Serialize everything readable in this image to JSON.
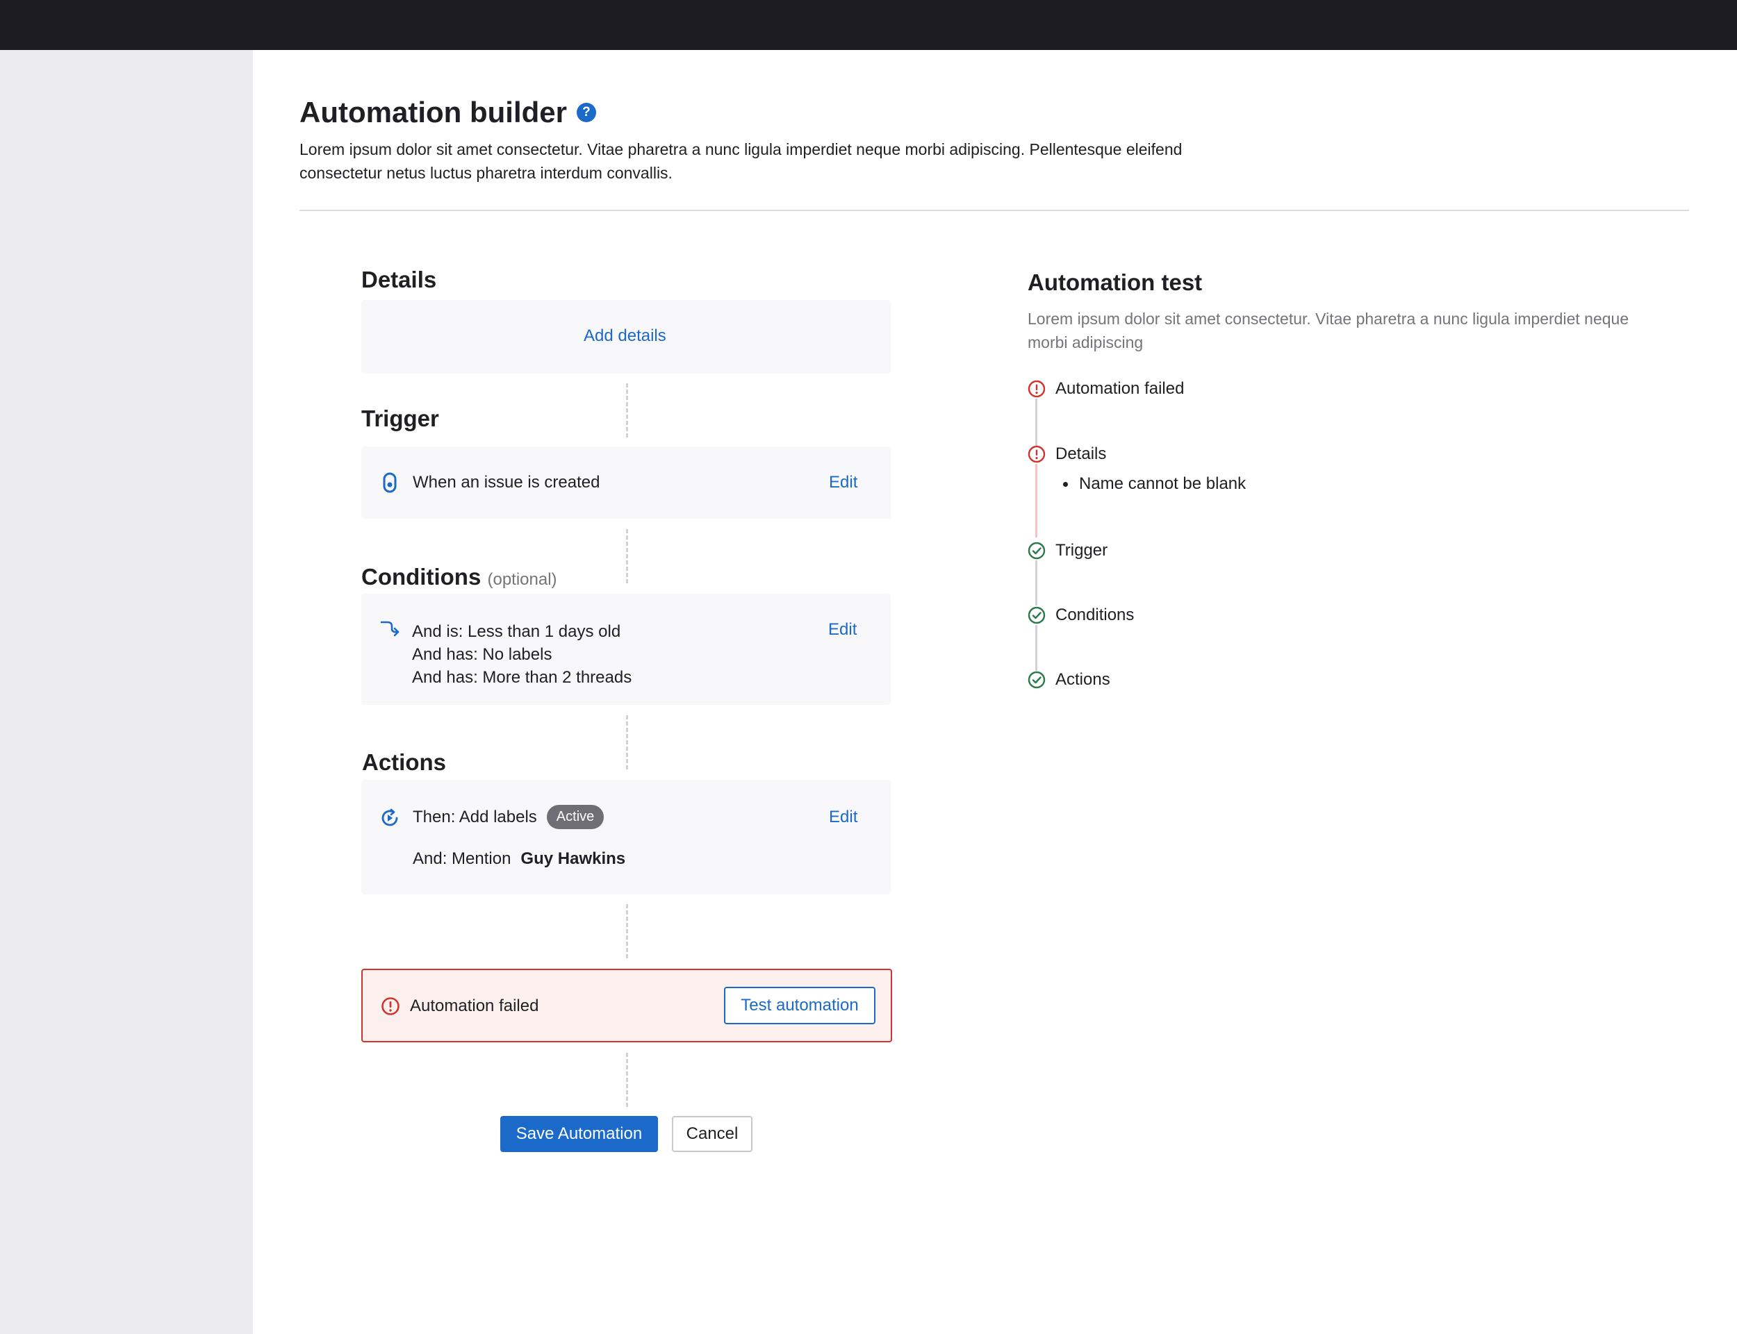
{
  "header": {
    "title": "Automation builder",
    "description": "Lorem ipsum dolor sit amet consectetur. Vitae pharetra a nunc ligula imperdiet neque morbi adipiscing. Pellentesque eleifend consectetur netus luctus pharetra interdum convallis."
  },
  "details": {
    "title": "Details",
    "add_label": "Add details"
  },
  "trigger": {
    "title": "Trigger",
    "text": "When an issue is created",
    "edit_label": "Edit"
  },
  "conditions": {
    "title": "Conditions",
    "optional_label": "(optional)",
    "lines": [
      "And is: Less than 1 days old",
      "And has: No labels",
      "And has: More than 2 threads"
    ],
    "edit_label": "Edit"
  },
  "actions": {
    "title": "Actions",
    "then_text": "Then: Add labels",
    "badge": "Active",
    "and_prefix": "And: Mention",
    "mention_name": "Guy Hawkins",
    "edit_label": "Edit"
  },
  "alert": {
    "text": "Automation failed",
    "button_label": "Test automation"
  },
  "footer": {
    "save_label": "Save Automation",
    "cancel_label": "Cancel"
  },
  "test_panel": {
    "title": "Automation test",
    "description": "Lorem ipsum dolor sit amet consectetur. Vitae pharetra a nunc ligula imperdiet neque morbi adipiscing",
    "steps": [
      {
        "label": "Automation failed",
        "status": "error"
      },
      {
        "label": "Details",
        "status": "error"
      },
      {
        "label": "Trigger",
        "status": "success"
      },
      {
        "label": "Conditions",
        "status": "success"
      },
      {
        "label": "Actions",
        "status": "success"
      }
    ],
    "details_error": "Name cannot be blank"
  },
  "colors": {
    "accent": "#1b6ac9",
    "error": "#d0342c",
    "success": "#2a7a4b",
    "topbar": "#1d1c24",
    "sidebar": "#ececee"
  }
}
